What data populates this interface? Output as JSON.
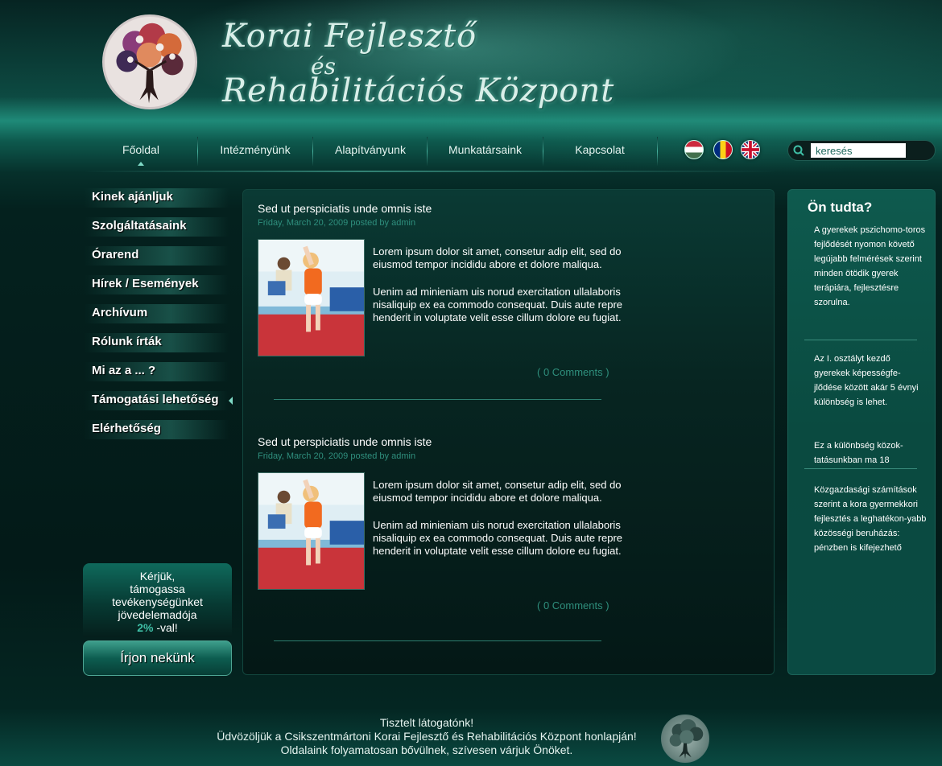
{
  "header": {
    "title_line1": "Korai Fejlesztő",
    "title_line2": "és",
    "title_line3": "Rehabilitációs Központ"
  },
  "nav": {
    "items": [
      {
        "label": "Főoldal",
        "active": true
      },
      {
        "label": "Intézményünk",
        "active": false
      },
      {
        "label": "Alapítványunk",
        "active": false
      },
      {
        "label": "Munkatársaink",
        "active": false
      },
      {
        "label": "Kapcsolat",
        "active": false
      }
    ]
  },
  "languages": [
    "hungarian-flag-icon",
    "romanian-flag-icon",
    "uk-flag-icon"
  ],
  "search": {
    "value": "keresés",
    "icon": "search-icon"
  },
  "sidebar": {
    "items": [
      {
        "label": "Kinek ajánljuk"
      },
      {
        "label": "Szolgáltatásaink"
      },
      {
        "label": "Órarend"
      },
      {
        "label": "Hírek / Események"
      },
      {
        "label": "Archívum"
      },
      {
        "label": "Rólunk írták"
      },
      {
        "label": "Mi az a ... ?"
      },
      {
        "label": "Támogatási lehetőség"
      },
      {
        "label": "Elérhetőség"
      }
    ],
    "active_index": 7
  },
  "donate": {
    "line1": "Kérjük,",
    "line2": "támogassa",
    "line3": "tevékenységünket",
    "line4": "jövedelemadója",
    "pct": "2%",
    "suffix": " -val!"
  },
  "write_button": "Írjon nekünk",
  "posts": [
    {
      "title": "Sed ut perspiciatis unde omnis iste",
      "meta": "Friday, March 20, 2009 posted by admin",
      "p1": "Lorem ipsum dolor sit amet, consetur adip elit, sed do eiusmod tempor incididu abore et dolore maliqua.",
      "p2": "Uenim ad minieniam uis norud exercitation ullalaboris nisaliquip ex ea commodo consequat. Duis aute repre henderit in voluptate velit esse cillum dolore eu fugiat.",
      "comments": "( 0 Comments )"
    },
    {
      "title": "Sed ut perspiciatis unde omnis iste",
      "meta": "Friday, March 20, 2009 posted by admin",
      "p1": "Lorem ipsum dolor sit amet, consetur adip elit, sed do eiusmod tempor incididu abore et dolore maliqua.",
      "p2": "Uenim ad minieniam uis norud exercitation ullalaboris nisaliquip ex ea commodo consequat. Duis aute repre henderit in voluptate velit esse cillum dolore eu fugiat.",
      "comments": "( 0 Comments )"
    }
  ],
  "facts": {
    "title": "Ön tudta?",
    "items": [
      "A gyerekek pszichomo-toros fejlődését nyomon követő legújabb felmérések szerint minden ötödik gyerek terápiára, fejlesztésre szorulna.",
      "Az I. osztályt kezdő gyerekek képességfe-jlődése között akár 5 évnyi különbség is lehet.",
      "Ez a különbség közok-tatásunkban ma 18",
      "Közgazdasági számítások szerint a kora gyermekkori fejlesztés a leghatékon-yabb közösségi beruházás: pénzben is kifejezhető"
    ]
  },
  "footer": {
    "line1": "Tisztelt látogatónk!",
    "line2": "Üdvözöljük a Csikszentmártoni Korai Fejlesztő és Rehabilitációs Központ honlapján!",
    "line3": "Oldalaink folyamatosan bővülnek, szívesen várjuk Önöket."
  }
}
